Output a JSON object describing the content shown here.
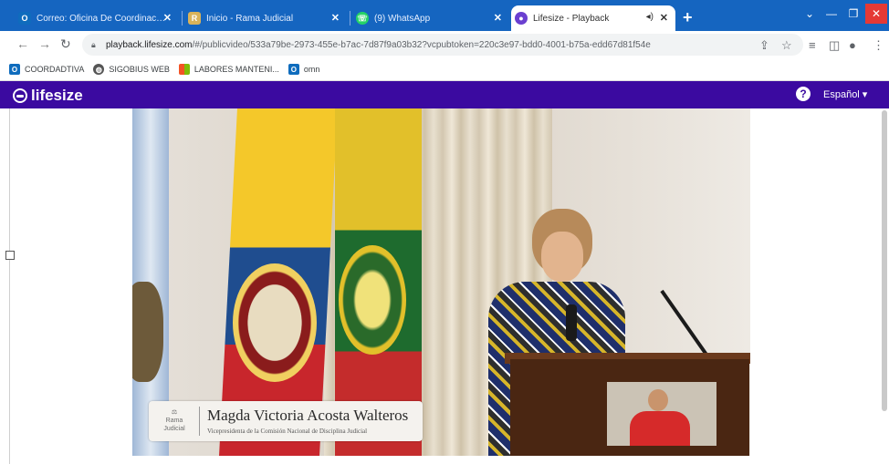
{
  "browser": {
    "tabs": [
      {
        "title": "Correo: Oficina De Coordinacion",
        "favicon": "outlook-icon",
        "close": "✕"
      },
      {
        "title": "Inicio - Rama Judicial",
        "favicon": "rama-judicial-icon",
        "close": "✕"
      },
      {
        "title": "(9) WhatsApp",
        "favicon": "whatsapp-icon",
        "close": "✕"
      },
      {
        "title": "Lifesize - Playback",
        "favicon": "lifesize-icon",
        "close": "✕",
        "active": true
      }
    ],
    "new_tab": "+",
    "url_host": "playback.lifesize.com",
    "url_rest": "/#/publicvideo/533a79be-2973-455e-b7ac-7d87f9a03b32?vcpubtoken=220c3e97-bdd0-4001-b75a-edd67d81f54e",
    "bookmarks": [
      {
        "label": "COORDADTIVA",
        "icon": "outlook-icon"
      },
      {
        "label": "SIGOBIUS WEB",
        "icon": "globe-icon"
      },
      {
        "label": "LABORES MANTENI...",
        "icon": "microsoft-icon"
      },
      {
        "label": "omn",
        "icon": "outlook-icon"
      }
    ]
  },
  "lifesize": {
    "brand": "lifesize",
    "help": "?",
    "language": "Español ▾"
  },
  "video": {
    "speaker_name": "Magda Victoria Acosta Walteros",
    "speaker_role": "Vicepresidenta de la Comisión Nacional de Disciplina Judicial",
    "emblem_text": "Rama Judicial"
  },
  "colors": {
    "tab_bar": "#1565c0",
    "lifesize_header": "#3b0aa0"
  }
}
